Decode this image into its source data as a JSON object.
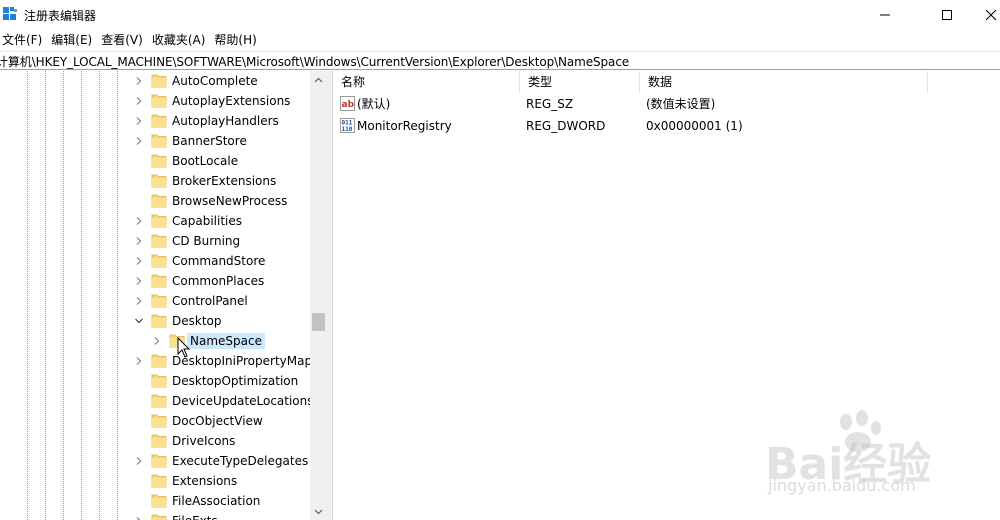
{
  "window": {
    "title": "注册表编辑器"
  },
  "menu": [
    {
      "label": "文件(F)"
    },
    {
      "label": "编辑(E)"
    },
    {
      "label": "查看(V)"
    },
    {
      "label": "收藏夹(A)"
    },
    {
      "label": "帮助(H)"
    }
  ],
  "address": {
    "path": "计算机\\HKEY_LOCAL_MACHINE\\SOFTWARE\\Microsoft\\Windows\\CurrentVersion\\Explorer\\Desktop\\NameSpace"
  },
  "tree": {
    "items": [
      {
        "label": "AutoComplete",
        "expander": "collapsed",
        "level": 0
      },
      {
        "label": "AutoplayExtensions",
        "expander": "collapsed",
        "level": 0
      },
      {
        "label": "AutoplayHandlers",
        "expander": "collapsed",
        "level": 0
      },
      {
        "label": "BannerStore",
        "expander": "collapsed",
        "level": 0
      },
      {
        "label": "BootLocale",
        "expander": "none",
        "level": 0
      },
      {
        "label": "BrokerExtensions",
        "expander": "none",
        "level": 0
      },
      {
        "label": "BrowseNewProcess",
        "expander": "none",
        "level": 0
      },
      {
        "label": "Capabilities",
        "expander": "collapsed",
        "level": 0
      },
      {
        "label": "CD Burning",
        "expander": "collapsed",
        "level": 0
      },
      {
        "label": "CommandStore",
        "expander": "collapsed",
        "level": 0
      },
      {
        "label": "CommonPlaces",
        "expander": "collapsed",
        "level": 0
      },
      {
        "label": "ControlPanel",
        "expander": "collapsed",
        "level": 0
      },
      {
        "label": "Desktop",
        "expander": "expanded",
        "level": 0
      },
      {
        "label": "NameSpace",
        "expander": "collapsed",
        "level": 1,
        "selected": true
      },
      {
        "label": "DesktopIniPropertyMap",
        "expander": "collapsed",
        "level": 0
      },
      {
        "label": "DesktopOptimization",
        "expander": "none",
        "level": 0
      },
      {
        "label": "DeviceUpdateLocations",
        "expander": "none",
        "level": 0
      },
      {
        "label": "DocObjectView",
        "expander": "none",
        "level": 0
      },
      {
        "label": "DriveIcons",
        "expander": "none",
        "level": 0
      },
      {
        "label": "ExecuteTypeDelegates",
        "expander": "collapsed",
        "level": 0
      },
      {
        "label": "Extensions",
        "expander": "none",
        "level": 0
      },
      {
        "label": "FileAssociation",
        "expander": "none",
        "level": 0
      },
      {
        "label": "FileExts",
        "expander": "collapsed",
        "level": 0
      }
    ]
  },
  "list": {
    "columns": [
      {
        "label": "名称"
      },
      {
        "label": "类型"
      },
      {
        "label": "数据"
      }
    ],
    "rows": [
      {
        "name": "(默认)",
        "type": "REG_SZ",
        "data": "(数值未设置)",
        "icon": "string-value-icon"
      },
      {
        "name": "MonitorRegistry",
        "type": "REG_DWORD",
        "data": "0x00000001 (1)",
        "icon": "binary-value-icon"
      }
    ]
  },
  "watermark": {
    "brand": "Bai经验",
    "site": "jingyan.baidu.com"
  },
  "colors": {
    "selection": "#cce8ff",
    "folder": "#f8d775",
    "folder_edge": "#e0b33c",
    "app_icon": "#1e7fd6"
  }
}
